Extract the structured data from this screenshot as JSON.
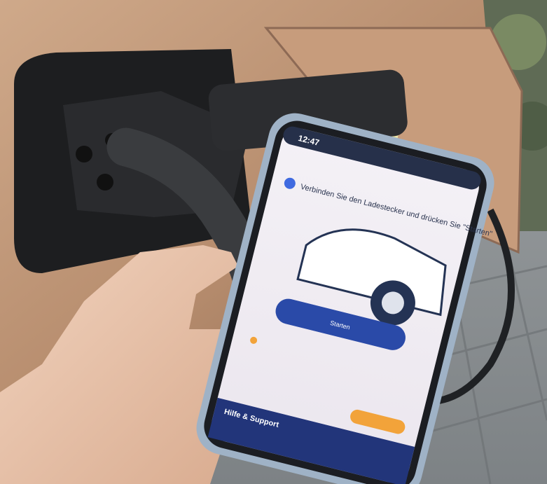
{
  "photo": {
    "subject": "hand holding a smartphone in front of an electric car charging port with a plugged-in charging cable"
  },
  "phone": {
    "status_time": "12:47",
    "instruction": "Verbinden Sie den Ladestecker und drücken Sie \"Starten\"",
    "start_button": "Starten",
    "help_title": "Hilfe & Support",
    "accent_blue": "#2a4aa8",
    "accent_orange": "#f2a33a"
  }
}
